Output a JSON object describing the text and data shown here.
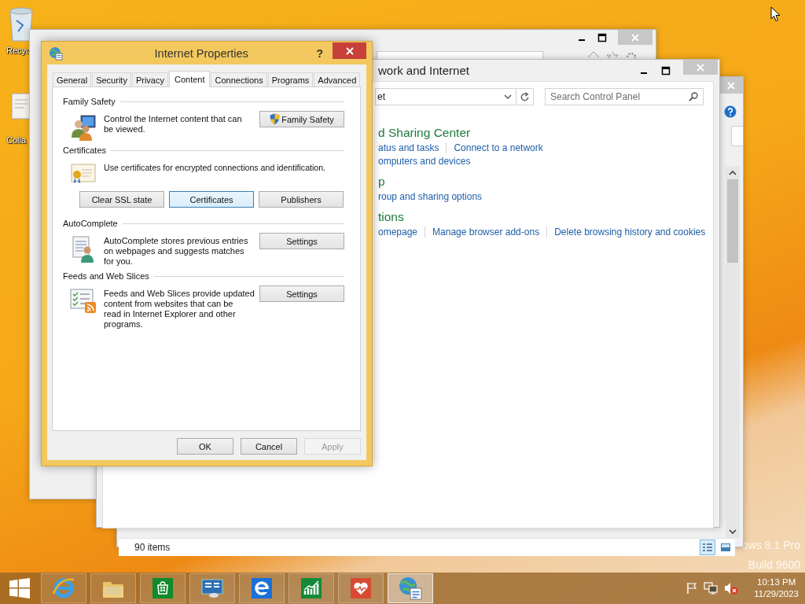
{
  "desktop": {
    "icons": [
      {
        "label": "Recyc"
      },
      {
        "label": "Colla"
      }
    ],
    "watermark": [
      "ows 8.1 Pro",
      "Build 9600"
    ]
  },
  "explorer_window": {
    "status": "90 items",
    "views": [
      {
        "selected": true
      },
      {
        "selected": false
      }
    ]
  },
  "control_panel": {
    "title": "work and Internet",
    "address": "et",
    "search": {
      "placeholder": "Search Control Panel"
    },
    "sections": [
      {
        "heading": "d Sharing Center",
        "lines": [
          [
            "atus and tasks",
            "Connect to a network"
          ],
          [
            "omputers and devices"
          ]
        ]
      },
      {
        "heading": "p",
        "lines": [
          [
            "roup and sharing options"
          ]
        ]
      },
      {
        "heading": "tions",
        "lines": [
          [
            "omepage",
            "Manage browser add-ons",
            "Delete browsing history and cookies"
          ]
        ]
      }
    ]
  },
  "dialog": {
    "title": "Internet Properties",
    "help": "?",
    "tabs": [
      {
        "label": "General",
        "selected": false
      },
      {
        "label": "Security",
        "selected": false
      },
      {
        "label": "Privacy",
        "selected": false
      },
      {
        "label": "Content",
        "selected": true
      },
      {
        "label": "Connections",
        "selected": false
      },
      {
        "label": "Programs",
        "selected": false
      },
      {
        "label": "Advanced",
        "selected": false
      }
    ],
    "groups": [
      {
        "heading": "Family Safety",
        "kind": "side",
        "description": "Control the Internet content that can\nbe viewed.",
        "buttons": [
          {
            "label": "Family Safety",
            "uac": true,
            "focused": false
          }
        ]
      },
      {
        "heading": "Certificates",
        "kind": "below",
        "description": "Use certificates for encrypted connections and identification.",
        "buttons": [
          {
            "label": "Clear SSL state",
            "uac": false,
            "focused": false
          },
          {
            "label": "Certificates",
            "uac": false,
            "focused": true
          },
          {
            "label": "Publishers",
            "uac": false,
            "focused": false
          }
        ]
      },
      {
        "heading": "AutoComplete",
        "kind": "side",
        "description": "AutoComplete stores previous entries\non webpages and suggests matches\nfor you.",
        "buttons": [
          {
            "label": "Settings",
            "uac": false,
            "focused": false
          }
        ]
      },
      {
        "heading": "Feeds and Web Slices",
        "kind": "side",
        "description": "Feeds and Web Slices provide updated\ncontent from websites that can be\nread in Internet Explorer and other\nprograms.",
        "buttons": [
          {
            "label": "Settings",
            "uac": false,
            "focused": false
          }
        ]
      }
    ],
    "footer": [
      {
        "label": "OK",
        "disabled": false
      },
      {
        "label": "Cancel",
        "disabled": false
      },
      {
        "label": "Apply",
        "disabled": true
      }
    ]
  },
  "taskbar": {
    "apps": [
      {
        "active": false
      },
      {
        "active": false
      },
      {
        "active": false
      },
      {
        "active": false
      },
      {
        "active": false
      },
      {
        "active": false
      },
      {
        "active": false
      },
      {
        "active": true
      }
    ],
    "time": "10:13 PM",
    "date": "11/29/2023"
  }
}
